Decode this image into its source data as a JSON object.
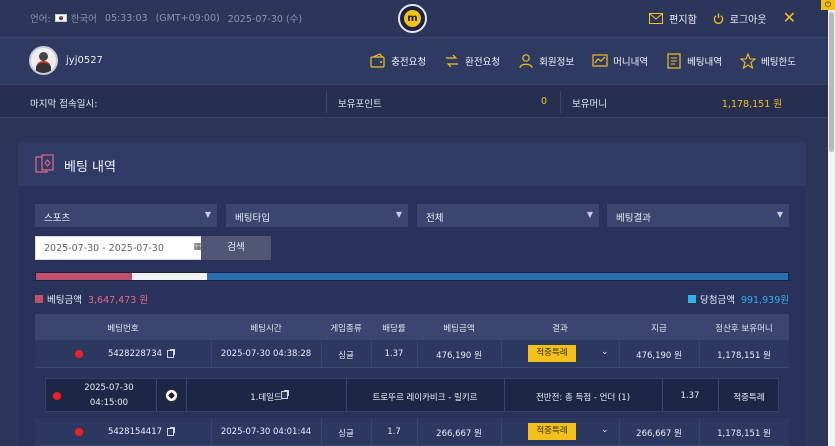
{
  "topbar": {
    "lang_label": "언어:",
    "lang_value": "한국어",
    "clock": "05:33:03",
    "timezone": "(GMT+09:00)",
    "date": "2025-07-30 (수)",
    "logo_letter": "m",
    "mail_label": "편지함",
    "logout_label": "로그아웃",
    "close_glyph": "✕"
  },
  "user": {
    "username": "jyj0527"
  },
  "nav": [
    {
      "label": "충전요청",
      "icon": "wallet-icon"
    },
    {
      "label": "환전요청",
      "icon": "exchange-icon"
    },
    {
      "label": "회원정보",
      "icon": "user-icon"
    },
    {
      "label": "머니내역",
      "icon": "chart-icon"
    },
    {
      "label": "베팅내역",
      "icon": "receipt-icon"
    },
    {
      "label": "베팅한도",
      "icon": "star-icon"
    }
  ],
  "info": {
    "last_login_label": "마지막 접속일시:",
    "points_label": "보유포인트",
    "points_value": "0",
    "money_label": "보유머니",
    "money_value": "1,178,151 원"
  },
  "panel": {
    "title": "베팅 내역"
  },
  "filters": [
    {
      "value": "스포츠"
    },
    {
      "value": "베팅타입"
    },
    {
      "value": "전체"
    },
    {
      "value": "베팅결과"
    }
  ],
  "date_range": "2025-07-30 - 2025-07-30",
  "search_label": "검색",
  "ratio": {
    "bet_fraction": 0.128,
    "mid_fraction": 0.1,
    "win_fraction": 0.772
  },
  "legend": {
    "bet_label": "베팅금액",
    "bet_value": "3,647,473 원",
    "win_label": "당첨금액",
    "win_value": "991,939원"
  },
  "colors": {
    "bet": "#c04f6c",
    "mid": "#f2f2f2",
    "win": "#2c6fb0",
    "accent": "#f2c019"
  },
  "table": {
    "headers": [
      "베팅번호",
      "베팅시간",
      "게임종류",
      "배당률",
      "베팅금액",
      "결과",
      "지급",
      "정산후 보유머니"
    ],
    "rows": [
      {
        "id": "5428228734",
        "time": "2025-07-30 04:38:28",
        "game": "싱글",
        "odds": "1.37",
        "amount": "476,190 원",
        "result": "적중특례",
        "payout": "476,190 원",
        "balance": "1,178,151 원"
      },
      {
        "id": "5428154417",
        "time": "2025-07-30 04:01:44",
        "game": "싱글",
        "odds": "1.7",
        "amount": "266,667 원",
        "result": "적중특례",
        "payout": "266,667 원",
        "balance": "1,178,151 원"
      }
    ],
    "detail": {
      "date": "2025-07-30",
      "time": "04:15:00",
      "league": "1.데일드",
      "match": "트로뚜르 레이카비크 - 릴키르",
      "market": "전반전: 총 득점 - 언더 (1)",
      "odds": "1.37",
      "result": "적중특례"
    }
  }
}
